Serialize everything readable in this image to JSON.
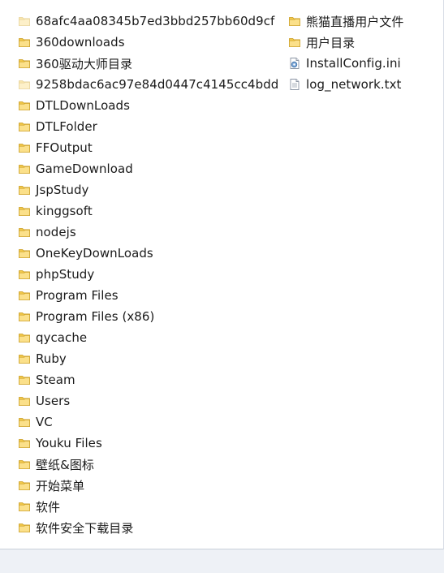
{
  "column1": [
    {
      "label": "68afc4aa08345b7ed3bbd257bb60d9cf",
      "icon": "folder-icon-faded"
    },
    {
      "label": "360downloads",
      "icon": "folder-icon"
    },
    {
      "label": "360驱动大师目录",
      "icon": "folder-icon"
    },
    {
      "label": "9258bdac6ac97e84d0447c4145cc4bdd",
      "icon": "folder-icon-faded"
    },
    {
      "label": "DTLDownLoads",
      "icon": "folder-icon"
    },
    {
      "label": "DTLFolder",
      "icon": "folder-icon"
    },
    {
      "label": "FFOutput",
      "icon": "folder-icon"
    },
    {
      "label": "GameDownload",
      "icon": "folder-icon"
    },
    {
      "label": "JspStudy",
      "icon": "folder-icon"
    },
    {
      "label": "kinggsoft",
      "icon": "folder-icon"
    },
    {
      "label": "nodejs",
      "icon": "folder-icon"
    },
    {
      "label": "OneKeyDownLoads",
      "icon": "folder-icon"
    },
    {
      "label": "phpStudy",
      "icon": "folder-icon"
    },
    {
      "label": "Program Files",
      "icon": "folder-icon"
    },
    {
      "label": "Program Files (x86)",
      "icon": "folder-icon"
    },
    {
      "label": "qycache",
      "icon": "folder-icon"
    },
    {
      "label": "Ruby",
      "icon": "folder-icon"
    },
    {
      "label": "Steam",
      "icon": "folder-icon"
    },
    {
      "label": "Users",
      "icon": "folder-icon"
    },
    {
      "label": "VC",
      "icon": "folder-icon"
    },
    {
      "label": "Youku Files",
      "icon": "folder-icon"
    },
    {
      "label": "壁纸&图标",
      "icon": "folder-icon"
    },
    {
      "label": "开始菜单",
      "icon": "folder-icon"
    },
    {
      "label": "软件",
      "icon": "folder-icon"
    },
    {
      "label": "软件安全下载目录",
      "icon": "folder-icon"
    }
  ],
  "column2": [
    {
      "label": "熊猫直播用户文件",
      "icon": "folder-icon"
    },
    {
      "label": "用户目录",
      "icon": "folder-icon"
    },
    {
      "label": "InstallConfig.ini",
      "icon": "config-file-icon"
    },
    {
      "label": "log_network.txt",
      "icon": "text-file-icon"
    }
  ],
  "colors": {
    "folder_body": "#f2c94c",
    "folder_front": "#fbe08a",
    "folder_edge": "#c99b1d",
    "pane_background": "#ffffff",
    "window_background": "#eef1f6"
  }
}
